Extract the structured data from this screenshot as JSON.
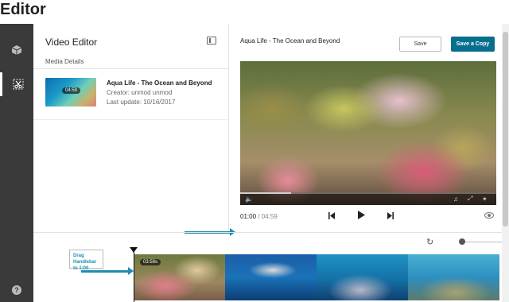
{
  "app": {
    "title": "Editor"
  },
  "rail": {
    "items": [
      {
        "icon": "cube-icon",
        "active": false
      },
      {
        "icon": "scissors-icon",
        "active": true
      },
      {
        "icon": "help-icon",
        "label": "?"
      }
    ]
  },
  "left_panel": {
    "title": "Video Editor",
    "subtitle": "Media Details",
    "media": {
      "title": "Aqua Life - The Ocean and Beyond",
      "creator": "Creator: unmod unmod",
      "last_update": "Last update: 10/16/2017",
      "thumb_duration": "04:59"
    }
  },
  "editor": {
    "video_title": "Aqua Life - The Ocean and Beyond",
    "save_label": "Save",
    "save_copy_label": "Save a Copy",
    "current_time": "01:00",
    "time_separator": " / ",
    "duration": "04:59",
    "progress_fraction": 0.2
  },
  "timeline": {
    "playhead_time": "03:59s",
    "callout": "Drag Handlebar to 1:00"
  },
  "colors": {
    "accent": "#066f8e",
    "arrow": "#1e8db0",
    "rail": "#3a3a3a"
  }
}
